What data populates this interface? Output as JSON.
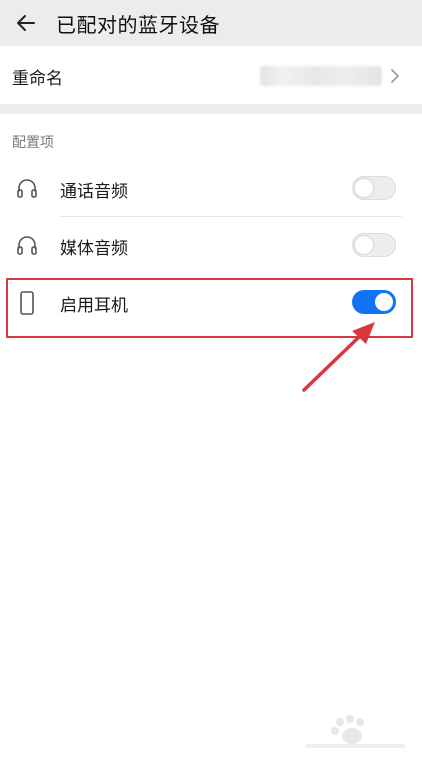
{
  "header": {
    "title": "已配对的蓝牙设备",
    "back_icon": "arrow-left-icon"
  },
  "rename": {
    "label": "重命名",
    "chevron_icon": "chevron-right-icon"
  },
  "config": {
    "section_label": "配置项",
    "items": [
      {
        "label": "通话音频",
        "icon": "headphones-icon",
        "enabled": false
      },
      {
        "label": "媒体音频",
        "icon": "headphones-icon",
        "enabled": false
      },
      {
        "label": "启用耳机",
        "icon": "phone-icon",
        "enabled": true
      }
    ]
  },
  "colors": {
    "toggle_on": "#1173f4",
    "toggle_off": "#eeeeee",
    "annotation_red": "#d9363e",
    "header_bg": "#ececec"
  }
}
